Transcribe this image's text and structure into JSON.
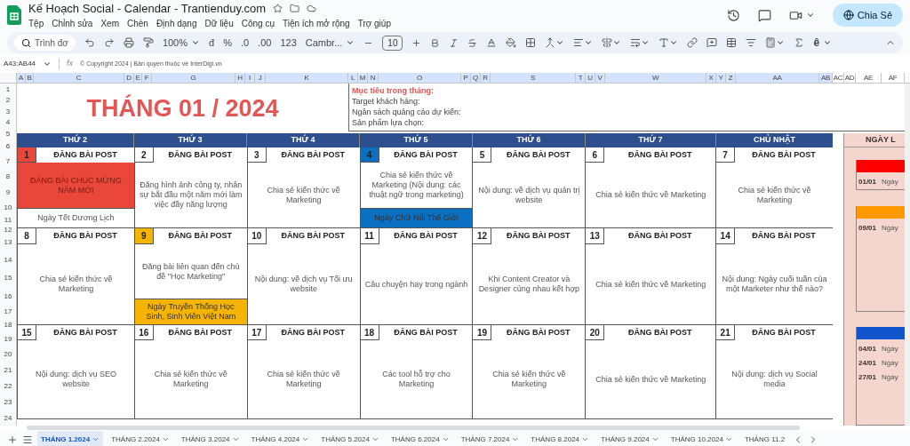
{
  "app": {
    "title": "Kế Hoạch Social - Calendar - Trantienduy.com",
    "menu": [
      "Tệp",
      "Chỉnh sửa",
      "Xem",
      "Chèn",
      "Định dạng",
      "Dữ liệu",
      "Công cụ",
      "Tiện ích mở rộng",
      "Trợ giúp"
    ],
    "share_button": "Chia Sẻ"
  },
  "toolbar": {
    "menu_search": "Trình đơ",
    "zoom": "100%",
    "currency": "đ",
    "percent": "%",
    "decrease_decimal": ".0",
    "increase_decimal": ".00",
    "number_format": "123",
    "font": "Cambr...",
    "font_size": "10",
    "input_tools": "ê"
  },
  "formula_bar": {
    "cell_range": "A43:AB44",
    "fx": "fx",
    "content": "© Copyright 2024 | Bản quyền thuộc về InterDigi.vn"
  },
  "column_headers": [
    {
      "label": "A",
      "selected": true
    },
    {
      "label": "B",
      "selected": true
    },
    {
      "label": "C",
      "selected": true
    },
    {
      "label": "D",
      "selected": true
    },
    {
      "label": "E",
      "selected": true
    },
    {
      "label": "F",
      "selected": true
    },
    {
      "label": "G",
      "selected": true
    },
    {
      "label": "H",
      "selected": true
    },
    {
      "label": "I",
      "selected": true
    },
    {
      "label": "J",
      "selected": true
    },
    {
      "label": "K",
      "selected": true
    },
    {
      "label": "L",
      "selected": true
    },
    {
      "label": "M",
      "selected": true
    },
    {
      "label": "N",
      "selected": true
    },
    {
      "label": "O",
      "selected": true
    },
    {
      "label": "P",
      "selected": true
    },
    {
      "label": "Q",
      "selected": true
    },
    {
      "label": "R",
      "selected": true
    },
    {
      "label": "S",
      "selected": true
    },
    {
      "label": "T",
      "selected": true
    },
    {
      "label": "U",
      "selected": true
    },
    {
      "label": "V",
      "selected": true
    },
    {
      "label": "W",
      "selected": true
    },
    {
      "label": "X",
      "selected": true
    },
    {
      "label": "Y",
      "selected": true
    },
    {
      "label": "Z",
      "selected": true
    },
    {
      "label": "AA",
      "selected": true
    },
    {
      "label": "AB",
      "selected": true
    },
    {
      "label": "AC",
      "selected": false
    },
    {
      "label": "AD",
      "selected": false
    },
    {
      "label": "AE",
      "selected": false
    },
    {
      "label": "AF",
      "selected": false
    }
  ],
  "row_headers": [
    "1",
    "2",
    "3",
    "4",
    "5",
    "6",
    "7",
    "8",
    "9",
    "10",
    "11",
    "12",
    "13",
    "14",
    "15",
    "16",
    "17",
    "18",
    "19",
    "20",
    "21",
    "22",
    "23",
    "24"
  ],
  "calendar": {
    "title": "THÁNG 01 / 2024",
    "goals": {
      "heading": "Mục tiêu trong tháng:",
      "lines": [
        "Target khách hàng:",
        "Ngân sách quảng cáo dự kiến:",
        "Sản phẩm lựa chọn:"
      ]
    },
    "weekdays": [
      "THỨ 2",
      "THỨ 3",
      "THỨ 4",
      "THỨ 5",
      "THỨ 6",
      "THỨ 7",
      "CHỦ NHẬT"
    ],
    "weeks": [
      [
        {
          "number": "1",
          "color": "#e8473a",
          "heading": "ĐĂNG BÀI POST",
          "content": "ĐĂNG BÀI CHÚC MỪNG NĂM MỚI",
          "highlighted": true,
          "event": {
            "text": "Ngày Tết Dương Lịch"
          }
        },
        {
          "number": "2",
          "heading": "ĐĂNG BÀI POST",
          "content": "Đăng hình ảnh công ty, nhân sự bắt đầu một năm mới làm việc đầy năng lượng",
          "highlighted": false
        },
        {
          "number": "3",
          "heading": "ĐĂNG BÀI POST",
          "content": "Chia sẻ kiến thức về Marketing",
          "highlighted": false
        },
        {
          "number": "4",
          "color": "#0b6fc2",
          "heading": "ĐĂNG BÀI POST",
          "content": "Chia sẻ kiến thức về Marketing (Nội dung: các thuật ngữ trong marketing)",
          "highlighted": false,
          "event": {
            "text": "Ngày Chữ Nổi Thế Giới",
            "color": "#0b6fc2"
          }
        },
        {
          "number": "5",
          "heading": "ĐĂNG BÀI POST",
          "content": "Nội dung: về dịch vụ quản trị website",
          "highlighted": false
        },
        {
          "number": "6",
          "heading": "ĐĂNG BÀI POST",
          "content": "Chia sẻ kiến thức về Marketing",
          "highlighted": false
        },
        {
          "number": "7",
          "heading": "ĐĂNG BÀI POST",
          "content": "Chia sẻ kiến thức về Marketing",
          "highlighted": false
        }
      ],
      [
        {
          "number": "8",
          "heading": "ĐĂNG BÀI POST",
          "content": "Chia sẻ kiến thức về Marketing",
          "highlighted": false
        },
        {
          "number": "9",
          "color": "#f5b400",
          "heading": "ĐĂNG BÀI POST",
          "content": "Đăng bài liên quan đến chủ đề \"Học Marketing\"",
          "highlighted": false,
          "event": {
            "text": "Ngày Truyền Thống Học Sinh, Sinh Viên Việt Nam",
            "color": "#f5b400"
          }
        },
        {
          "number": "10",
          "heading": "ĐĂNG BÀI POST",
          "content": "Nội dung: về dịch vụ Tối ưu website",
          "highlighted": false
        },
        {
          "number": "11",
          "heading": "ĐĂNG BÀI POST",
          "content": "Câu chuyện hay trong ngành",
          "highlighted": false
        },
        {
          "number": "12",
          "heading": "ĐĂNG BÀI POST",
          "content": "Khi Content Creator và Designer cùng nhau kết hợp",
          "highlighted": false
        },
        {
          "number": "13",
          "heading": "ĐĂNG BÀI POST",
          "content": "Chia sẻ kiến thức về Marketing",
          "highlighted": false
        },
        {
          "number": "14",
          "heading": "ĐĂNG BÀI POST",
          "content": "Nội dung: Ngày cuối tuần của một Marketer như thế nào?",
          "highlighted": false
        }
      ],
      [
        {
          "number": "15",
          "heading": "ĐĂNG BÀI POST",
          "content": "Nội dung: dịch vụ SEO website",
          "highlighted": false
        },
        {
          "number": "16",
          "heading": "ĐĂNG BÀI POST",
          "content": "Chia sẻ kiến thức về Marketing",
          "highlighted": false
        },
        {
          "number": "17",
          "heading": "ĐĂNG BÀI POST",
          "content": "Chia sẻ kiến thức về Marketing",
          "highlighted": false
        },
        {
          "number": "18",
          "heading": "ĐĂNG BÀI POST",
          "content": "Các tool hỗ trợ cho Marketing",
          "highlighted": false
        },
        {
          "number": "19",
          "heading": "ĐĂNG BÀI POST",
          "content": "Chia sẻ kiến thức về Marketing",
          "highlighted": false
        },
        {
          "number": "20",
          "heading": "ĐĂNG BÀI POST",
          "content": "Chia sẻ kiến thức về Marketing",
          "highlighted": false
        },
        {
          "number": "21",
          "heading": "ĐĂNG BÀI POST",
          "content": "Nội dung: dịch vụ Social media",
          "highlighted": false
        }
      ]
    ]
  },
  "holidays": {
    "heading": "NGÀY L",
    "groups": [
      {
        "color": "#ff0000",
        "items": [
          {
            "date": "01/01",
            "name": "Ngày"
          }
        ]
      },
      {
        "color": "#ff9900",
        "items": [
          {
            "date": "09/01",
            "name": "Ngày"
          }
        ]
      },
      {
        "color": "#1155cc",
        "items": [
          {
            "date": "04/01",
            "name": "Ngày"
          },
          {
            "date": "24/01",
            "name": "Ngày"
          },
          {
            "date": "27/01",
            "name": "Ngày"
          }
        ]
      }
    ]
  },
  "sheet_tabs": [
    {
      "label": "THÁNG 1.2024",
      "selected": true
    },
    {
      "label": "THÁNG 2.2024",
      "selected": false
    },
    {
      "label": "THÁNG 3.2024",
      "selected": false
    },
    {
      "label": "THÁNG 4.2024",
      "selected": false
    },
    {
      "label": "THÁNG 5.2024",
      "selected": false
    },
    {
      "label": "THÁNG 6.2024",
      "selected": false
    },
    {
      "label": "THÁNG 7.2024",
      "selected": false
    },
    {
      "label": "THÁNG 8.2024",
      "selected": false
    },
    {
      "label": "THÁNG 9.2024",
      "selected": false
    },
    {
      "label": "THÁNG 10.2024",
      "selected": false
    },
    {
      "label": "THÁNG 11.2",
      "selected": false
    }
  ]
}
